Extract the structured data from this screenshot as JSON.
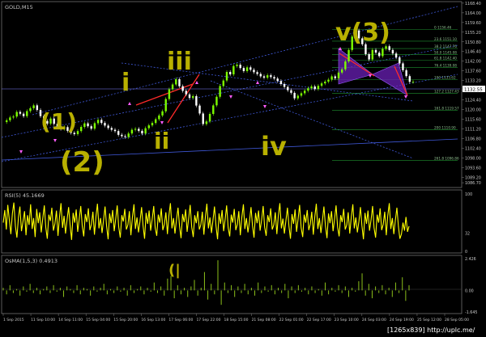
{
  "window": {
    "title": "GOLD,M15",
    "watermark": "[1265x839] http://uplc.me/"
  },
  "colors": {
    "background": "#000000",
    "bull_candle": "#7CFC00",
    "bear_candle": "#ffffff",
    "annotation": "#b8b000",
    "channel": "#3f58d8",
    "fib": "#1f8f2f",
    "harmonic": "#6a1fb5",
    "trend_red": "#ff2a2a",
    "arrow_marker": "#ff5cff",
    "rsi": "#ffff00",
    "macd_hist": "#8bbf1a",
    "axis_text": "#c8c8c8"
  },
  "chart_data": [
    {
      "panel": "main",
      "type": "line",
      "title": "GOLD,M15",
      "ylim": [
        1086,
        1168
      ],
      "y_ticks": [
        "1168.40",
        "1164.00",
        "1159.60",
        "1155.20",
        "1150.80",
        "1146.40",
        "1142.00",
        "1137.60",
        "1133.20",
        "1128.80",
        "1124.40",
        "1120.00",
        "1115.60",
        "1111.20",
        "1106.80",
        "1102.40",
        "1098.00",
        "1093.60",
        "1089.20",
        "1086.70"
      ],
      "current_price": "1132.55",
      "x_ticks": [
        "1 Sep 2015",
        "11 Sep 10:00",
        "14 Sep 11:00",
        "15 Sep 04:00",
        "15 Sep 20:00",
        "16 Sep 13:00",
        "17 Sep 06:00",
        "17 Sep 22:00",
        "18 Sep 15:00",
        "21 Sep 08:00",
        "22 Sep 01:00",
        "22 Sep 17:00",
        "23 Sep 10:00",
        "24 Sep 03:00",
        "24 Sep 19:00",
        "25 Sep 12:00",
        "28 Sep 05:00"
      ],
      "series": [
        {
          "values": [
            1114.3,
            1115.1,
            1116.4,
            1116.8,
            1118.9,
            1118.1,
            1117.0,
            1119.3,
            1120.6,
            1121.9,
            1119.8,
            1117.0,
            1114.8,
            1113.6,
            1115.9,
            1113.5,
            1112.4,
            1111.2,
            1112.0,
            1110.3,
            1109.4,
            1108.8,
            1110.2,
            1112.1,
            1113.7,
            1112.4,
            1111.3,
            1113.8,
            1115.3,
            1113.9,
            1112.7,
            1111.6,
            1110.8,
            1110.2,
            1108.5,
            1107.9,
            1107.5,
            1109.1,
            1110.8,
            1111.2,
            1110.3,
            1109.1,
            1111.5,
            1112.8,
            1113.9,
            1115.6,
            1117.3,
            1119.2,
            1124.8,
            1129.2,
            1131.4,
            1133.8,
            1130.6,
            1128.5,
            1126.9,
            1125.3,
            1126.1,
            1121.8,
            1118.2,
            1113.4,
            1114.6,
            1118.0,
            1121.9,
            1125.8,
            1130.7,
            1133.2,
            1137.1,
            1136.0,
            1139.8,
            1140.4,
            1138.9,
            1137.5,
            1139.2,
            1138.1,
            1137.0,
            1136.2,
            1135.1,
            1134.5,
            1135.6,
            1134.8,
            1134.1,
            1133.0,
            1131.6,
            1130.3,
            1128.8,
            1127.6,
            1125.1,
            1126.3,
            1127.4,
            1128.6,
            1129.7,
            1130.5,
            1129.3,
            1130.8,
            1131.9,
            1132.7,
            1133.6,
            1135.1,
            1134.2,
            1136.8,
            1138.3,
            1141.9,
            1147.1,
            1153.2,
            1156.0,
            1152.4,
            1149.7,
            1145.2,
            1142.8,
            1147.1,
            1145.9,
            1144.3,
            1147.6,
            1148.8,
            1147.1,
            1145.5,
            1143.7,
            1141.0,
            1137.9,
            1135.2,
            1132.6,
            1132.6
          ]
        }
      ],
      "fib_levels": [
        "0 1156.46",
        "23.6 1151.10",
        "38.2 1147.76",
        "50.0 1145.08",
        "61.8 1142.40",
        "76.4 1139.08",
        "100 1133.62",
        "127.2 1127.43",
        "161.8 1119.57",
        "200 1110.90",
        "261.8 1096.86"
      ],
      "annotations": [
        "(1)",
        "(2)",
        "i",
        "iii",
        "ii",
        "iv",
        "v(3)",
        "(|"
      ]
    },
    {
      "panel": "rsi",
      "type": "line",
      "title": "RSI(5) 45.1669",
      "ylim": [
        0,
        100
      ],
      "y_ticks": [
        "100",
        "32",
        "0"
      ],
      "series": [
        {
          "values": [
            50,
            72,
            38,
            81,
            55,
            30,
            66,
            85,
            44,
            24,
            60,
            78,
            35,
            52,
            70,
            28,
            63,
            46,
            82,
            39,
            58,
            25,
            74,
            49,
            68,
            33,
            57,
            80,
            42,
            22,
            64,
            53,
            76,
            36,
            48,
            71,
            27,
            59,
            84,
            41,
            62,
            31,
            55,
            77,
            45,
            20,
            67,
            50,
            73,
            34,
            56,
            79,
            43,
            26,
            65,
            51,
            75,
            37,
            47,
            69,
            29,
            61,
            83,
            40,
            58,
            32,
            54,
            78,
            44,
            21,
            66,
            49,
            72,
            35,
            57,
            80,
            42,
            24,
            63,
            52,
            74,
            38,
            46,
            70,
            28,
            60,
            82,
            39,
            59,
            33,
            53,
            77,
            45,
            22,
            67,
            48,
            71,
            36,
            56,
            79,
            41,
            27,
            64,
            50,
            75,
            37,
            47,
            68,
            30,
            62,
            84,
            40,
            58,
            31,
            55,
            76,
            43,
            23,
            65,
            51,
            73,
            34,
            57,
            81,
            42,
            25,
            63,
            49,
            70,
            38,
            46,
            69,
            29,
            61,
            83,
            40,
            59,
            32,
            54,
            78,
            44,
            21,
            66,
            48,
            72,
            35,
            56,
            80,
            41,
            26,
            64,
            50,
            74,
            37,
            47,
            70,
            28,
            60,
            82,
            39,
            58,
            33,
            52,
            77,
            45,
            24,
            67,
            49,
            71,
            36,
            55,
            79,
            42,
            27,
            63,
            51,
            75,
            38,
            46,
            68,
            30,
            62,
            84,
            40,
            57,
            31,
            54,
            76,
            43,
            22,
            65,
            48,
            73,
            34,
            56,
            81,
            41,
            25,
            64,
            50,
            72,
            37,
            47,
            69,
            29,
            61,
            83,
            39,
            58,
            32,
            53,
            78,
            44,
            23,
            66,
            49,
            70,
            35,
            57,
            80,
            42,
            26,
            63,
            51,
            74,
            38,
            46,
            68,
            31,
            60,
            82,
            40,
            59,
            33,
            52,
            77,
            45,
            21,
            67,
            48,
            71,
            36,
            55,
            79,
            41,
            24,
            64,
            50,
            75,
            37,
            47,
            69,
            28,
            62,
            84,
            39,
            58,
            30,
            54,
            76,
            43,
            22,
            30,
            50,
            36,
            60,
            34,
            44
          ]
        }
      ]
    },
    {
      "panel": "macd",
      "type": "bar",
      "title": "OsMA(1,5,3) 0.4913",
      "ylim": [
        -1.645,
        2.426
      ],
      "y_ticks": [
        "2.426",
        "0.00",
        "-1.645"
      ],
      "series": [
        {
          "values": [
            0.2,
            -0.3,
            0.4,
            -0.2,
            0.1,
            -0.4,
            0.3,
            -0.1,
            0.5,
            -0.2,
            0.2,
            -0.3,
            0.1,
            0.3,
            -0.2,
            0.4,
            -0.1,
            0.2,
            -0.5,
            0.3,
            0.1,
            -0.2,
            0.4,
            -0.3,
            0.2,
            0.1,
            -0.4,
            0.3,
            -0.1,
            0.2,
            0.5,
            -0.3,
            0.1,
            -0.2,
            0.3,
            -0.1,
            0.2,
            -0.4,
            0.4,
            -0.2,
            0.1,
            0.3,
            -0.3,
            0.2,
            -0.1,
            0.6,
            -0.2,
            0.3,
            -0.4,
            0.9,
            1.1,
            -0.6,
            0.4,
            -0.3,
            0.2,
            -0.5,
            0.3,
            0.8,
            -0.4,
            0.2,
            1.4,
            -0.7,
            0.5,
            -0.3,
            2.3,
            -1.1,
            0.6,
            -0.2,
            0.4,
            -0.5,
            0.3,
            -0.2,
            0.5,
            -0.3,
            0.2,
            -0.4,
            0.6,
            -0.2,
            0.3,
            -0.1,
            0.4,
            -0.3,
            0.2,
            -0.2,
            0.5,
            -0.6,
            0.3,
            -0.2,
            0.4,
            -0.1,
            0.2,
            -0.3,
            0.3,
            -0.2,
            0.1,
            -0.4,
            0.6,
            -0.3,
            0.2,
            -0.1,
            0.4,
            -0.2,
            0.3,
            -0.5,
            0.2,
            -0.1,
            0.7,
            1.3,
            -0.4,
            0.5,
            -0.6,
            0.3,
            -0.2,
            0.4,
            -0.3,
            0.2,
            -0.5,
            0.6,
            -0.2,
            1.0,
            -0.8,
            0.4
          ]
        }
      ]
    }
  ]
}
